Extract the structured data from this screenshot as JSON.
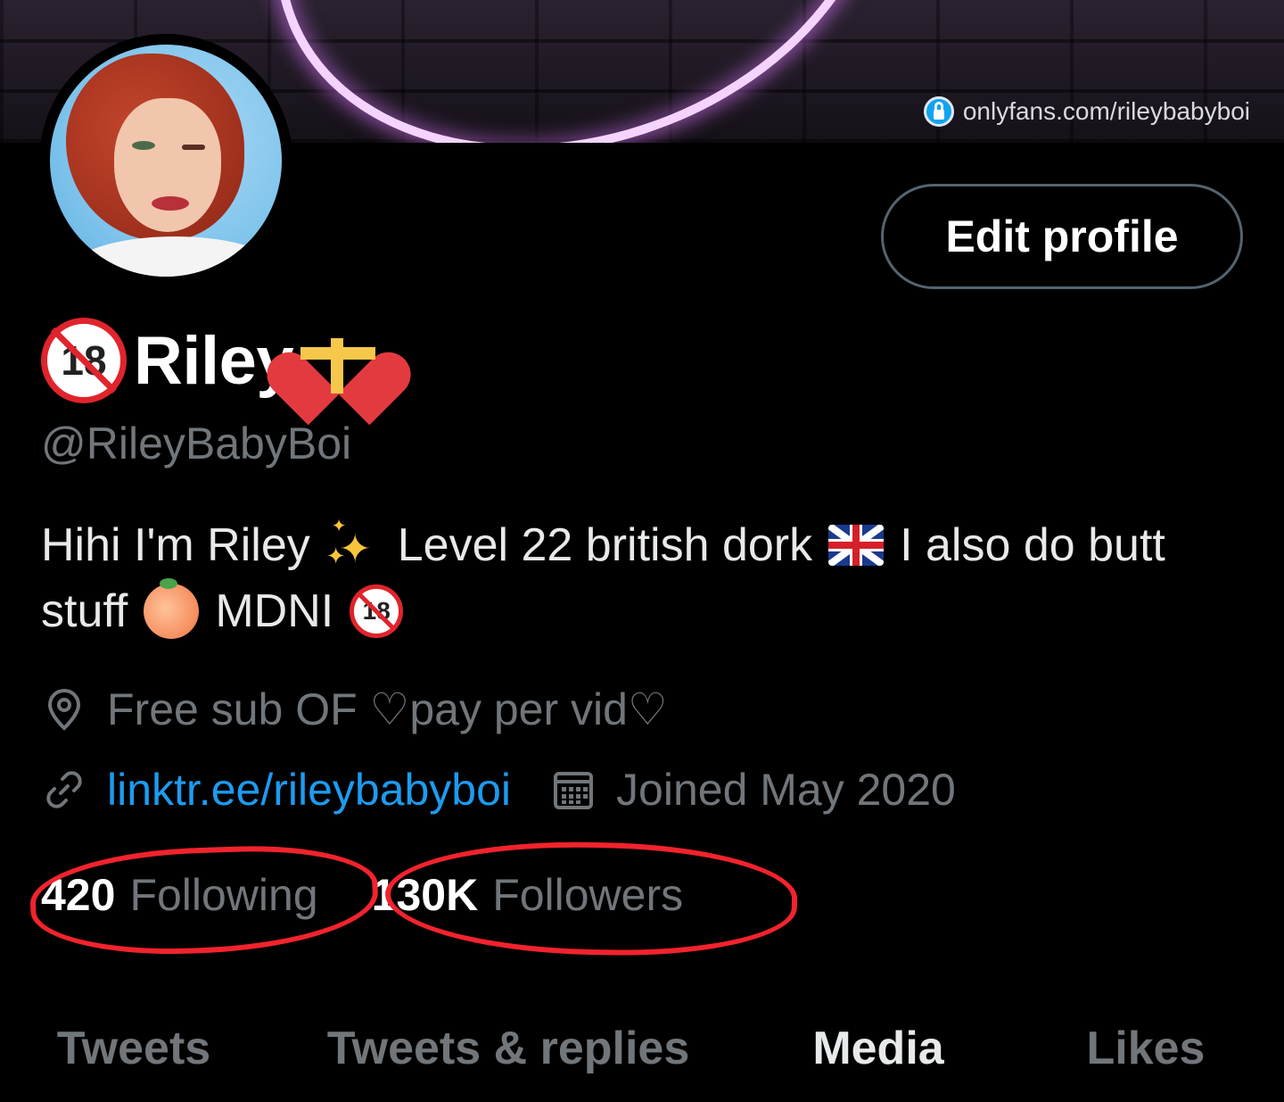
{
  "banner": {
    "link_text": "onlyfans.com/rileybabyboi"
  },
  "profile": {
    "edit_button": "Edit profile",
    "display_name": "Riley",
    "handle": "@RileyBabyBoi",
    "no18_text": "18",
    "bio": {
      "line1_a": "Hihi I'm Riley",
      "line1_b": "Level 22 british dork",
      "line1_c": "I also do butt",
      "line2_a": "stuff",
      "line2_b": "MDNI"
    },
    "location": "Free sub OF ♡pay per vid♡",
    "website": "linktr.ee/rileybabyboi",
    "joined": "Joined May 2020",
    "following_count": "420",
    "following_label": "Following",
    "followers_count": "130K",
    "followers_label": "Followers"
  },
  "tabs": [
    {
      "label": "Tweets",
      "active": false
    },
    {
      "label": "Tweets & replies",
      "active": false
    },
    {
      "label": "Media",
      "active": true
    },
    {
      "label": "Likes",
      "active": false
    }
  ],
  "colors": {
    "background": "#000000",
    "link": "#1d9bf0",
    "secondary_text": "#71767b",
    "annotation_red": "#f2232d"
  },
  "icons": {
    "location": "location-pin-icon",
    "website": "link-icon",
    "joined": "calendar-icon",
    "banner_lock": "lock-icon",
    "name_emoji_1": "no-under-18-icon",
    "name_emoji_2": "heart-with-ribbon-icon",
    "bio_emoji_1": "sparkles-icon",
    "bio_emoji_2": "uk-flag-icon",
    "bio_emoji_3": "peach-icon",
    "bio_emoji_4": "no-under-18-icon"
  }
}
